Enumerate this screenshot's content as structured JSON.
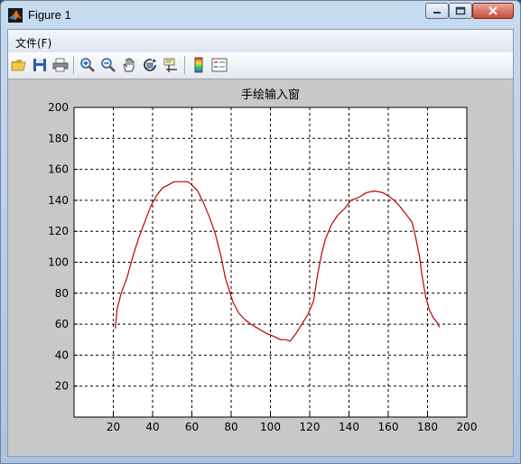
{
  "window": {
    "title": "Figure 1",
    "icon": "matlab-logo-icon",
    "controls": [
      "minimize-icon",
      "maximize-icon",
      "close-icon"
    ]
  },
  "menu": {
    "items": [
      {
        "label": "文件(F)"
      }
    ]
  },
  "toolbar": {
    "tools": [
      {
        "name": "open-file-button",
        "icon": "folder-open-icon"
      },
      {
        "name": "save-button",
        "icon": "save-icon"
      },
      {
        "name": "print-button",
        "icon": "printer-icon"
      },
      {
        "name": "zoom-in-button",
        "icon": "zoom-in-icon"
      },
      {
        "name": "zoom-out-button",
        "icon": "zoom-out-icon"
      },
      {
        "name": "pan-button",
        "icon": "hand-icon"
      },
      {
        "name": "rotate-3d-button",
        "icon": "rotate-icon"
      },
      {
        "name": "data-cursor-button",
        "icon": "data-cursor-icon"
      },
      {
        "name": "colorbar-button",
        "icon": "colorbar-icon"
      },
      {
        "name": "legend-button",
        "icon": "legend-icon"
      }
    ]
  },
  "colors": {
    "line": "#c00000",
    "grid": "#000000",
    "figure_background": "#c8c8c8",
    "axes_background": "#ffffff"
  },
  "chart_data": {
    "type": "line",
    "title": "手绘输入窗",
    "xlabel": "",
    "ylabel": "",
    "xlim": [
      0,
      200
    ],
    "ylim": [
      0,
      200
    ],
    "xticks": [
      20,
      40,
      60,
      80,
      100,
      120,
      140,
      160,
      180,
      200
    ],
    "yticks": [
      20,
      40,
      60,
      80,
      100,
      120,
      140,
      160,
      180,
      200
    ],
    "grid": true,
    "series": [
      {
        "x": [
          21,
          22,
          24,
          27,
          30,
          33,
          36,
          39,
          42,
          45,
          48,
          51,
          55,
          58,
          60,
          63,
          66,
          69,
          72,
          75,
          77,
          79,
          81,
          84,
          87,
          90,
          94,
          98,
          102,
          105,
          108,
          110,
          113,
          116,
          119,
          122,
          124,
          126,
          128,
          131,
          134,
          138,
          141,
          145,
          149,
          153,
          157,
          160,
          163,
          166,
          169,
          172,
          174,
          176,
          177,
          179,
          181,
          183,
          185,
          186
        ],
        "y": [
          57,
          70,
          80,
          90,
          104,
          116,
          126,
          136,
          143,
          148,
          150,
          152,
          152,
          152,
          150,
          146,
          138,
          129,
          118,
          103,
          90,
          82,
          74,
          67,
          63,
          60,
          57,
          54,
          52,
          50,
          50,
          49,
          54,
          60,
          66,
          75,
          92,
          105,
          115,
          124,
          130,
          135,
          140,
          142,
          145,
          146,
          145,
          143,
          140,
          136,
          131,
          126,
          116,
          103,
          93,
          78,
          69,
          64,
          61,
          58
        ]
      }
    ]
  }
}
